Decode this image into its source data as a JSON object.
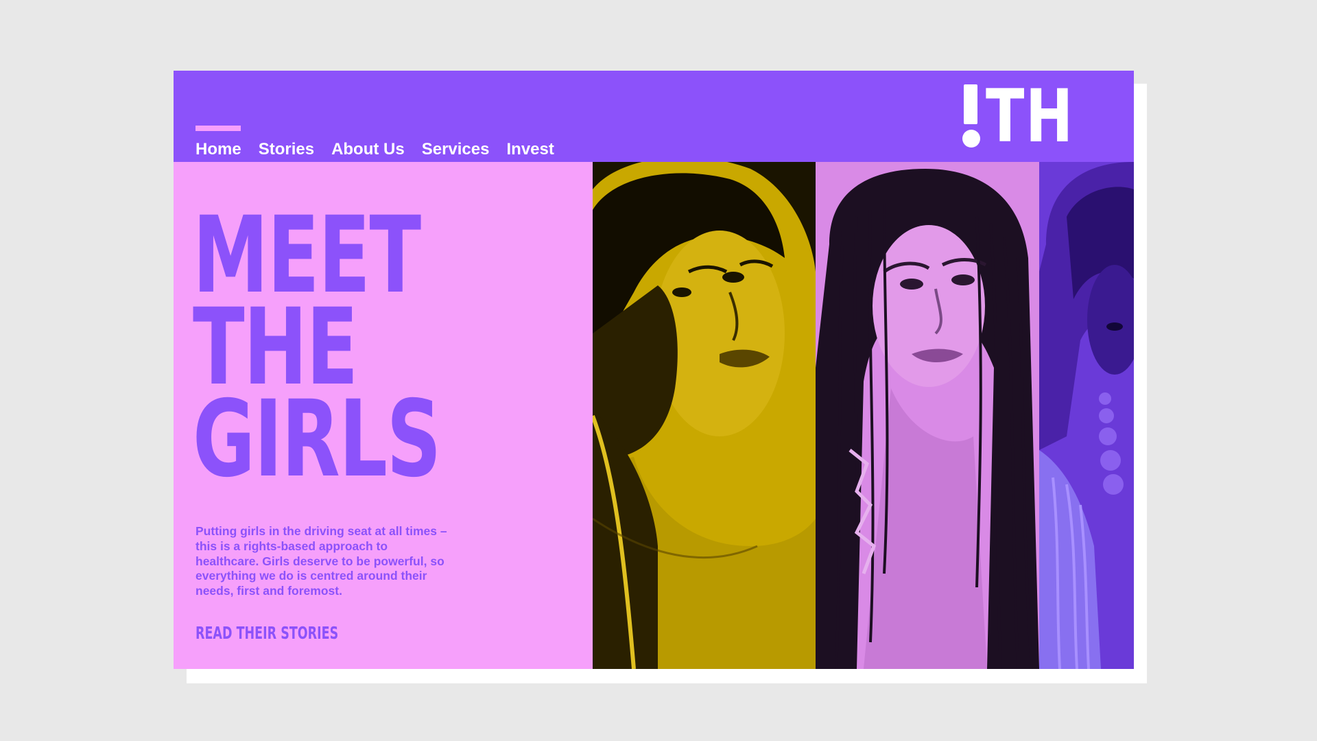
{
  "brand": {
    "logo_text": "TH",
    "logo_icon": "exclamation-mark-icon"
  },
  "nav": {
    "items": [
      {
        "label": "Home",
        "active": true
      },
      {
        "label": "Stories",
        "active": false
      },
      {
        "label": "About Us",
        "active": false
      },
      {
        "label": "Services",
        "active": false
      },
      {
        "label": "Invest",
        "active": false
      }
    ]
  },
  "hero": {
    "headline": [
      "MEET",
      "THE",
      "GIRLS"
    ],
    "body": "Putting girls in the driving seat at all times – this is a rights-based approach to healthcare. Girls deserve to be powerful, so everything we do is centred around their needs, first and foremost.",
    "cta": "READ THEIR STORIES"
  },
  "photos": [
    {
      "tint": "#c9a800"
    },
    {
      "tint": "#d98ae6"
    },
    {
      "tint": "#6a3ad8"
    }
  ],
  "colors": {
    "primary": "#8c52fa",
    "secondary": "#f6a0fb",
    "background": "#e8e8e8",
    "white": "#ffffff"
  }
}
